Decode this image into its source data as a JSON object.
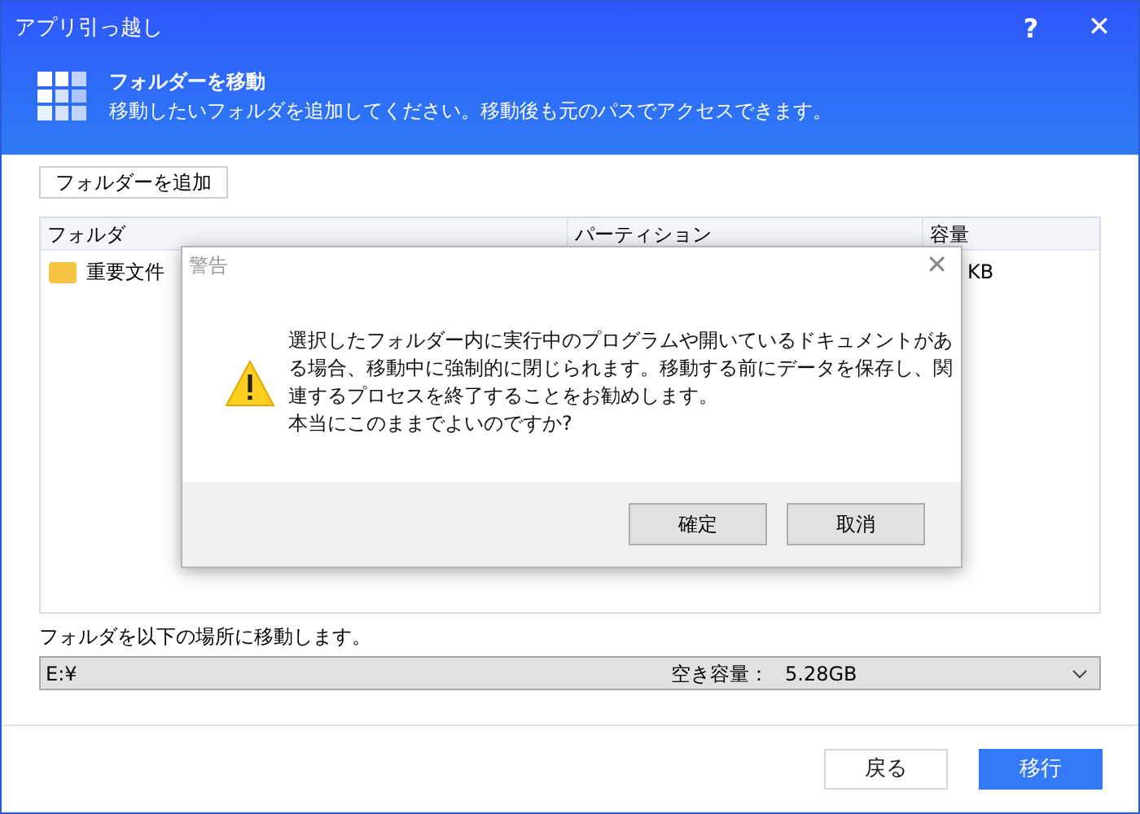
{
  "window": {
    "title": "アプリ引っ越し",
    "help": "?",
    "close": "✕"
  },
  "header": {
    "title": "フォルダーを移動",
    "subtitle": "移動したいフォルダを追加してください。移動後も元のパスでアクセスできます。"
  },
  "add_button": "フォルダーを追加",
  "table": {
    "columns": [
      "フォルダ",
      "パーティション",
      "容量"
    ],
    "rows": [
      {
        "name": "重要文件",
        "size": "KB"
      }
    ]
  },
  "destination": {
    "label": "フォルダを以下の場所に移動します。",
    "value": "E:¥",
    "free_label": "空き容量：",
    "free_value": "5.28GB"
  },
  "buttons": [
    {
      "label": "戻る",
      "kind": "secondary"
    },
    {
      "label": "移行",
      "kind": "primary"
    }
  ],
  "dialog": {
    "title": "警告",
    "close": "✕",
    "message": [
      "選択したフォルダー内に実行中のプログラムや開いているドキュメントがあ",
      "る場合、移動中に強制的に閉じられます。移動する前にデータを保存し、関",
      "連するプロセスを終了することをお勧めします。",
      "本当にこのままでよいのですか?"
    ],
    "buttons": [
      "確定",
      "取消"
    ]
  }
}
